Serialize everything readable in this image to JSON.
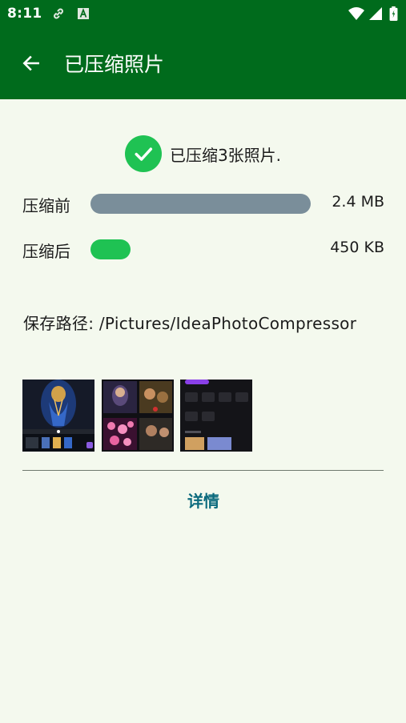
{
  "status_bar": {
    "time": "8:11",
    "icons": [
      "link-icon",
      "a-box-icon",
      "wifi-icon",
      "signal-icon",
      "battery-icon"
    ]
  },
  "appbar": {
    "title": "已压缩照片",
    "back_icon": "arrow-left-icon"
  },
  "summary": {
    "message": "已压缩3张照片.",
    "icon": "check-circle-icon"
  },
  "before": {
    "label": "压缩前",
    "size": "2.4 MB",
    "ratio": 1.0
  },
  "after": {
    "label": "压缩后",
    "size": "450 KB",
    "ratio": 0.18
  },
  "save_path": {
    "text": "保存路径: /Pictures/IdeaPhotoCompressor"
  },
  "thumbnails": [
    {
      "name": "thumbnail-1",
      "description": "video-editor-screenshot"
    },
    {
      "name": "thumbnail-2",
      "description": "photo-grid-screenshot"
    },
    {
      "name": "thumbnail-3",
      "description": "app-menu-screenshot"
    }
  ],
  "details_button": {
    "label": "详情"
  },
  "colors": {
    "app_bar": "#006b1c",
    "background": "#f4f9ee",
    "success": "#1fc253",
    "bar_before": "#7a8e9a",
    "bar_after": "#1fc253",
    "link": "#0b6a7d"
  }
}
